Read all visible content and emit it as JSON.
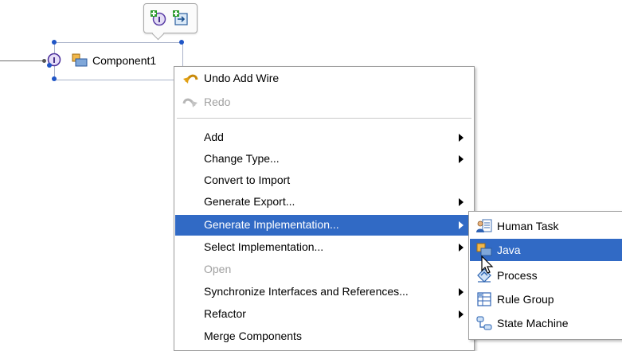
{
  "canvas": {
    "component": {
      "label": "Component1"
    },
    "hover_bar": {
      "icons": [
        "add-interface-icon",
        "add-reference-icon"
      ]
    }
  },
  "context_menu": {
    "items": [
      {
        "label": "Undo Add Wire",
        "icon": "undo-icon",
        "enabled": true
      },
      {
        "label": "Redo",
        "icon": "redo-icon",
        "enabled": false
      },
      {
        "label": "Add",
        "submenu": true,
        "enabled": true
      },
      {
        "label": "Change Type...",
        "submenu": true,
        "enabled": true
      },
      {
        "label": "Convert to Import",
        "submenu": false,
        "enabled": true
      },
      {
        "label": "Generate Export...",
        "submenu": true,
        "enabled": true
      },
      {
        "label": "Generate Implementation...",
        "submenu": true,
        "enabled": true,
        "selected": true
      },
      {
        "label": "Select Implementation...",
        "submenu": true,
        "enabled": true
      },
      {
        "label": "Open",
        "submenu": false,
        "enabled": false
      },
      {
        "label": "Synchronize Interfaces and References...",
        "submenu": true,
        "enabled": true
      },
      {
        "label": "Refactor",
        "submenu": true,
        "enabled": true
      },
      {
        "label": "Merge Components",
        "submenu": false,
        "enabled": true
      }
    ]
  },
  "submenu": {
    "items": [
      {
        "label": "Human Task",
        "icon": "human-task-icon"
      },
      {
        "label": "Java",
        "icon": "java-icon",
        "selected": true
      },
      {
        "label": "Process",
        "icon": "process-icon"
      },
      {
        "label": "Rule Group",
        "icon": "rule-group-icon"
      },
      {
        "label": "State Machine",
        "icon": "state-machine-icon"
      }
    ]
  },
  "colors": {
    "selection": "#316ac5",
    "disabled_text": "#a0a0a0",
    "handle": "#1f55c6"
  }
}
